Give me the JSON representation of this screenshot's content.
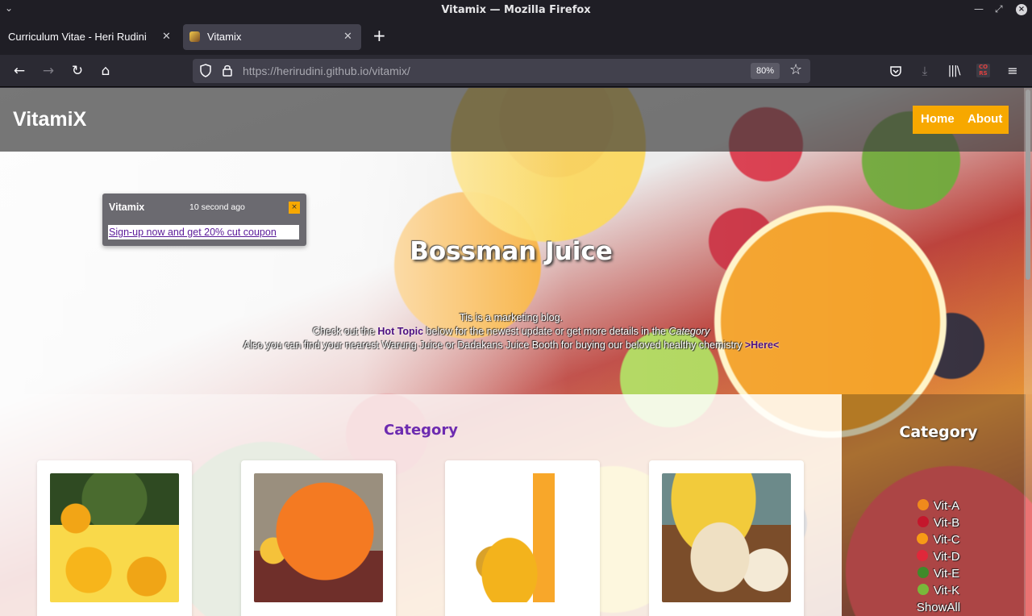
{
  "window": {
    "title": "Vitamix — Mozilla Firefox"
  },
  "tabs": [
    {
      "label": "Curriculum Vitae - Heri Rudini"
    },
    {
      "label": "Vitamix"
    }
  ],
  "urlbar": {
    "host": "https://herirudini.github.io",
    "path": "/vitamix/",
    "zoom": "80%"
  },
  "site": {
    "brand": "VitamiX",
    "nav": {
      "home": "Home",
      "about": "About"
    },
    "hero": {
      "title": "Bossman Juice",
      "line1": "Tis is a marketing blog.",
      "line2_a": "Check out the ",
      "line2_hot": "Hot Topic",
      "line2_b": " below for the newest update or get more details in the ",
      "line2_cat": "Category",
      "line3_a": "Also you can find your nearest Warung Juice or Dadakans Juice Booth for buying our beloved healthy chemistry ",
      "line3_here": ">Here<"
    },
    "toast": {
      "title": "Vitamix",
      "time": "10 second ago",
      "close": "×",
      "link": "Sign-up now and get 20% cut coupon"
    },
    "category": {
      "title": "Category"
    },
    "sidebar": {
      "title": "Category",
      "items": [
        "Vit-A",
        "Vit-B",
        "Vit-C",
        "Vit-D",
        "Vit-E",
        "Vit-K",
        "ShowAll"
      ],
      "icon_names": [
        "carrot-icon",
        "cherry-icon",
        "orange-icon",
        "strawberry-icon",
        "broccoli-icon",
        "kiwi-icon"
      ]
    },
    "colors": {
      "accent": "#f7a800",
      "brand_purple": "#6d2bb0"
    }
  }
}
